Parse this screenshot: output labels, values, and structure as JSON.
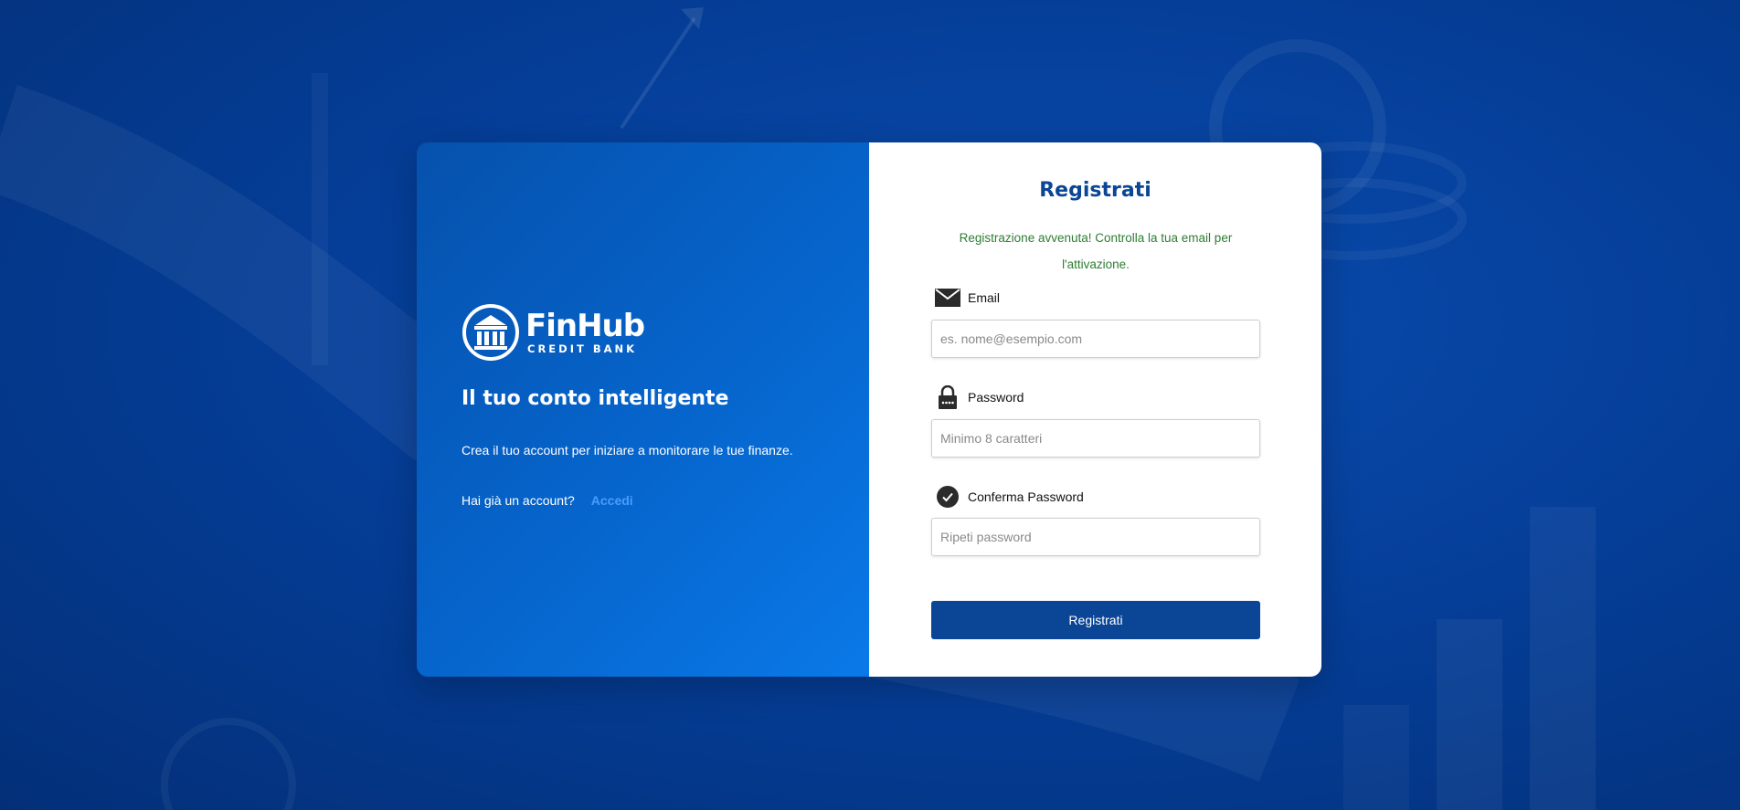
{
  "brand": {
    "name": "FinHub",
    "subtitle": "CREDIT BANK"
  },
  "left_panel": {
    "tagline": "Il tuo conto intelligente",
    "description": "Crea il tuo account per iniziare a monitorare le tue finanze.",
    "login_prompt": "Hai già un account?",
    "login_link": "Accedi"
  },
  "form": {
    "title": "Registrati",
    "success_message": "Registrazione avvenuta! Controlla la tua email per l'attivazione.",
    "fields": {
      "email": {
        "label": "Email",
        "placeholder": "es. nome@esempio.com",
        "value": "",
        "icon": "envelope-icon"
      },
      "password": {
        "label": "Password",
        "placeholder": "Minimo 8 caratteri",
        "value": "",
        "icon": "lock-icon"
      },
      "confirm": {
        "label": "Conferma Password",
        "placeholder": "Ripeti password",
        "value": "",
        "icon": "check-circle-icon"
      }
    },
    "submit_label": "Registrati"
  },
  "colors": {
    "primary": "#0a4596",
    "success": "#2e7d32",
    "link": "#4a9cff",
    "background": "#053f9a"
  }
}
